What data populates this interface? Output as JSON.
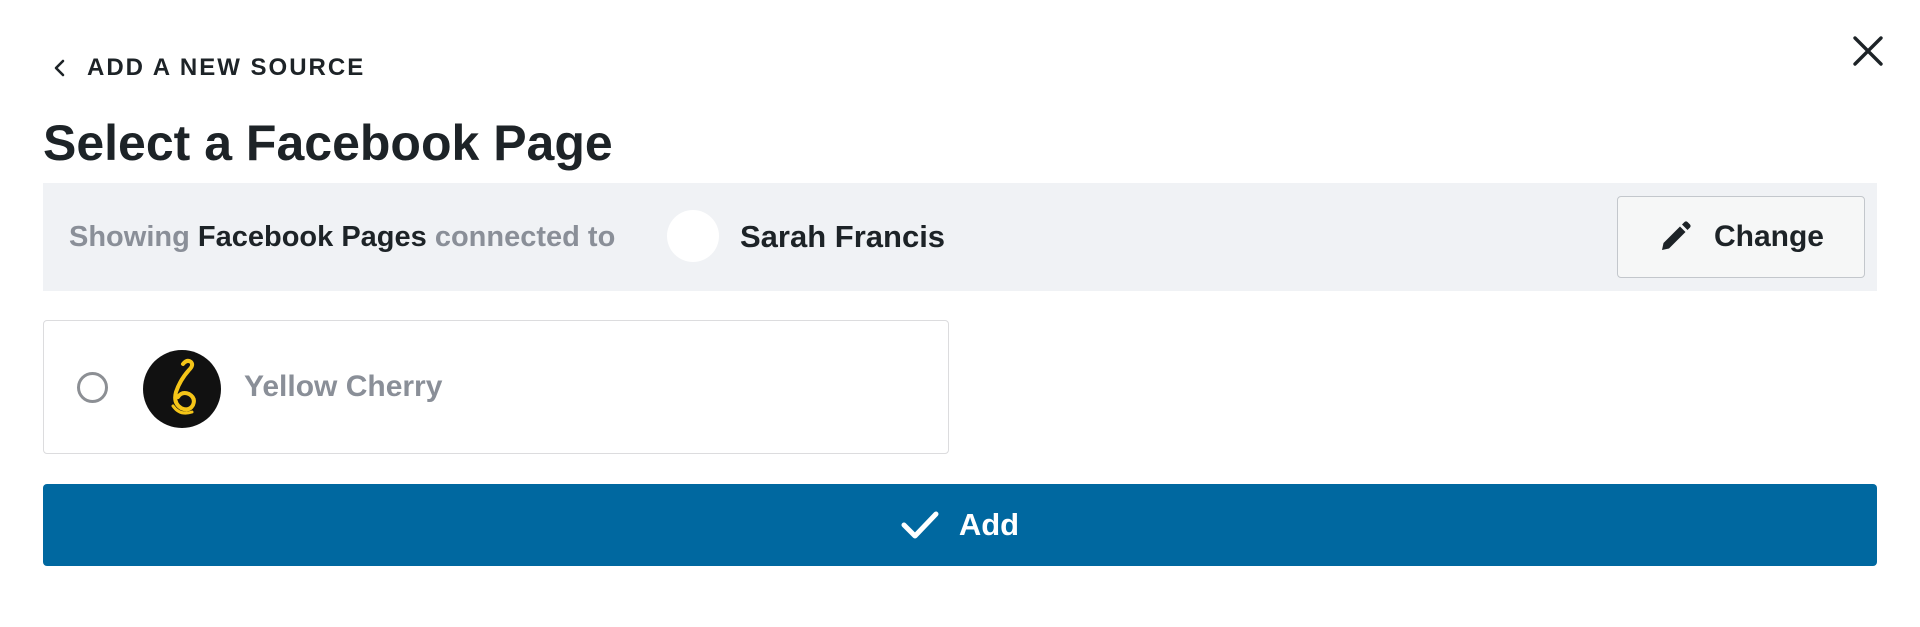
{
  "header": {
    "back_label": "ADD A NEW SOURCE",
    "back_icon": "chevron-left-icon",
    "close_icon": "close-icon"
  },
  "title": "Select a Facebook Page",
  "connection": {
    "prefix": "Showing",
    "pages_label": "Facebook Pages",
    "connected_to": "connected to",
    "account_name": "Sarah Francis",
    "change_label": "Change",
    "change_icon": "pencil-icon"
  },
  "pages": [
    {
      "name": "Yellow Cherry",
      "selected": false,
      "avatar_icon": "yellow-cherry-logo"
    }
  ],
  "actions": {
    "add_label": "Add",
    "add_icon": "checkmark-icon"
  },
  "colors": {
    "primary": "#0068a0",
    "bar_background": "#f0f2f5",
    "muted_text": "#8a8f98",
    "text": "#1d2327",
    "logo_yellow": "#f5c518"
  }
}
